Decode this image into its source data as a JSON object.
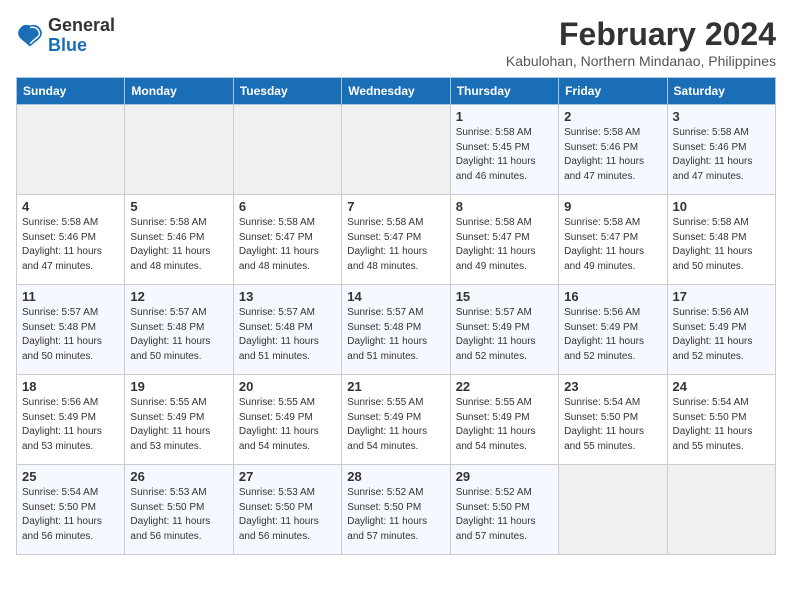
{
  "header": {
    "logo_general": "General",
    "logo_blue": "Blue",
    "month_year": "February 2024",
    "location": "Kabulohan, Northern Mindanao, Philippines"
  },
  "weekdays": [
    "Sunday",
    "Monday",
    "Tuesday",
    "Wednesday",
    "Thursday",
    "Friday",
    "Saturday"
  ],
  "weeks": [
    [
      {
        "day": "",
        "sunrise": "",
        "sunset": "",
        "daylight": ""
      },
      {
        "day": "",
        "sunrise": "",
        "sunset": "",
        "daylight": ""
      },
      {
        "day": "",
        "sunrise": "",
        "sunset": "",
        "daylight": ""
      },
      {
        "day": "",
        "sunrise": "",
        "sunset": "",
        "daylight": ""
      },
      {
        "day": "1",
        "sunrise": "Sunrise: 5:58 AM",
        "sunset": "Sunset: 5:45 PM",
        "daylight": "Daylight: 11 hours and 46 minutes."
      },
      {
        "day": "2",
        "sunrise": "Sunrise: 5:58 AM",
        "sunset": "Sunset: 5:46 PM",
        "daylight": "Daylight: 11 hours and 47 minutes."
      },
      {
        "day": "3",
        "sunrise": "Sunrise: 5:58 AM",
        "sunset": "Sunset: 5:46 PM",
        "daylight": "Daylight: 11 hours and 47 minutes."
      }
    ],
    [
      {
        "day": "4",
        "sunrise": "Sunrise: 5:58 AM",
        "sunset": "Sunset: 5:46 PM",
        "daylight": "Daylight: 11 hours and 47 minutes."
      },
      {
        "day": "5",
        "sunrise": "Sunrise: 5:58 AM",
        "sunset": "Sunset: 5:46 PM",
        "daylight": "Daylight: 11 hours and 48 minutes."
      },
      {
        "day": "6",
        "sunrise": "Sunrise: 5:58 AM",
        "sunset": "Sunset: 5:47 PM",
        "daylight": "Daylight: 11 hours and 48 minutes."
      },
      {
        "day": "7",
        "sunrise": "Sunrise: 5:58 AM",
        "sunset": "Sunset: 5:47 PM",
        "daylight": "Daylight: 11 hours and 48 minutes."
      },
      {
        "day": "8",
        "sunrise": "Sunrise: 5:58 AM",
        "sunset": "Sunset: 5:47 PM",
        "daylight": "Daylight: 11 hours and 49 minutes."
      },
      {
        "day": "9",
        "sunrise": "Sunrise: 5:58 AM",
        "sunset": "Sunset: 5:47 PM",
        "daylight": "Daylight: 11 hours and 49 minutes."
      },
      {
        "day": "10",
        "sunrise": "Sunrise: 5:58 AM",
        "sunset": "Sunset: 5:48 PM",
        "daylight": "Daylight: 11 hours and 50 minutes."
      }
    ],
    [
      {
        "day": "11",
        "sunrise": "Sunrise: 5:57 AM",
        "sunset": "Sunset: 5:48 PM",
        "daylight": "Daylight: 11 hours and 50 minutes."
      },
      {
        "day": "12",
        "sunrise": "Sunrise: 5:57 AM",
        "sunset": "Sunset: 5:48 PM",
        "daylight": "Daylight: 11 hours and 50 minutes."
      },
      {
        "day": "13",
        "sunrise": "Sunrise: 5:57 AM",
        "sunset": "Sunset: 5:48 PM",
        "daylight": "Daylight: 11 hours and 51 minutes."
      },
      {
        "day": "14",
        "sunrise": "Sunrise: 5:57 AM",
        "sunset": "Sunset: 5:48 PM",
        "daylight": "Daylight: 11 hours and 51 minutes."
      },
      {
        "day": "15",
        "sunrise": "Sunrise: 5:57 AM",
        "sunset": "Sunset: 5:49 PM",
        "daylight": "Daylight: 11 hours and 52 minutes."
      },
      {
        "day": "16",
        "sunrise": "Sunrise: 5:56 AM",
        "sunset": "Sunset: 5:49 PM",
        "daylight": "Daylight: 11 hours and 52 minutes."
      },
      {
        "day": "17",
        "sunrise": "Sunrise: 5:56 AM",
        "sunset": "Sunset: 5:49 PM",
        "daylight": "Daylight: 11 hours and 52 minutes."
      }
    ],
    [
      {
        "day": "18",
        "sunrise": "Sunrise: 5:56 AM",
        "sunset": "Sunset: 5:49 PM",
        "daylight": "Daylight: 11 hours and 53 minutes."
      },
      {
        "day": "19",
        "sunrise": "Sunrise: 5:55 AM",
        "sunset": "Sunset: 5:49 PM",
        "daylight": "Daylight: 11 hours and 53 minutes."
      },
      {
        "day": "20",
        "sunrise": "Sunrise: 5:55 AM",
        "sunset": "Sunset: 5:49 PM",
        "daylight": "Daylight: 11 hours and 54 minutes."
      },
      {
        "day": "21",
        "sunrise": "Sunrise: 5:55 AM",
        "sunset": "Sunset: 5:49 PM",
        "daylight": "Daylight: 11 hours and 54 minutes."
      },
      {
        "day": "22",
        "sunrise": "Sunrise: 5:55 AM",
        "sunset": "Sunset: 5:49 PM",
        "daylight": "Daylight: 11 hours and 54 minutes."
      },
      {
        "day": "23",
        "sunrise": "Sunrise: 5:54 AM",
        "sunset": "Sunset: 5:50 PM",
        "daylight": "Daylight: 11 hours and 55 minutes."
      },
      {
        "day": "24",
        "sunrise": "Sunrise: 5:54 AM",
        "sunset": "Sunset: 5:50 PM",
        "daylight": "Daylight: 11 hours and 55 minutes."
      }
    ],
    [
      {
        "day": "25",
        "sunrise": "Sunrise: 5:54 AM",
        "sunset": "Sunset: 5:50 PM",
        "daylight": "Daylight: 11 hours and 56 minutes."
      },
      {
        "day": "26",
        "sunrise": "Sunrise: 5:53 AM",
        "sunset": "Sunset: 5:50 PM",
        "daylight": "Daylight: 11 hours and 56 minutes."
      },
      {
        "day": "27",
        "sunrise": "Sunrise: 5:53 AM",
        "sunset": "Sunset: 5:50 PM",
        "daylight": "Daylight: 11 hours and 56 minutes."
      },
      {
        "day": "28",
        "sunrise": "Sunrise: 5:52 AM",
        "sunset": "Sunset: 5:50 PM",
        "daylight": "Daylight: 11 hours and 57 minutes."
      },
      {
        "day": "29",
        "sunrise": "Sunrise: 5:52 AM",
        "sunset": "Sunset: 5:50 PM",
        "daylight": "Daylight: 11 hours and 57 minutes."
      },
      {
        "day": "",
        "sunrise": "",
        "sunset": "",
        "daylight": ""
      },
      {
        "day": "",
        "sunrise": "",
        "sunset": "",
        "daylight": ""
      }
    ]
  ]
}
